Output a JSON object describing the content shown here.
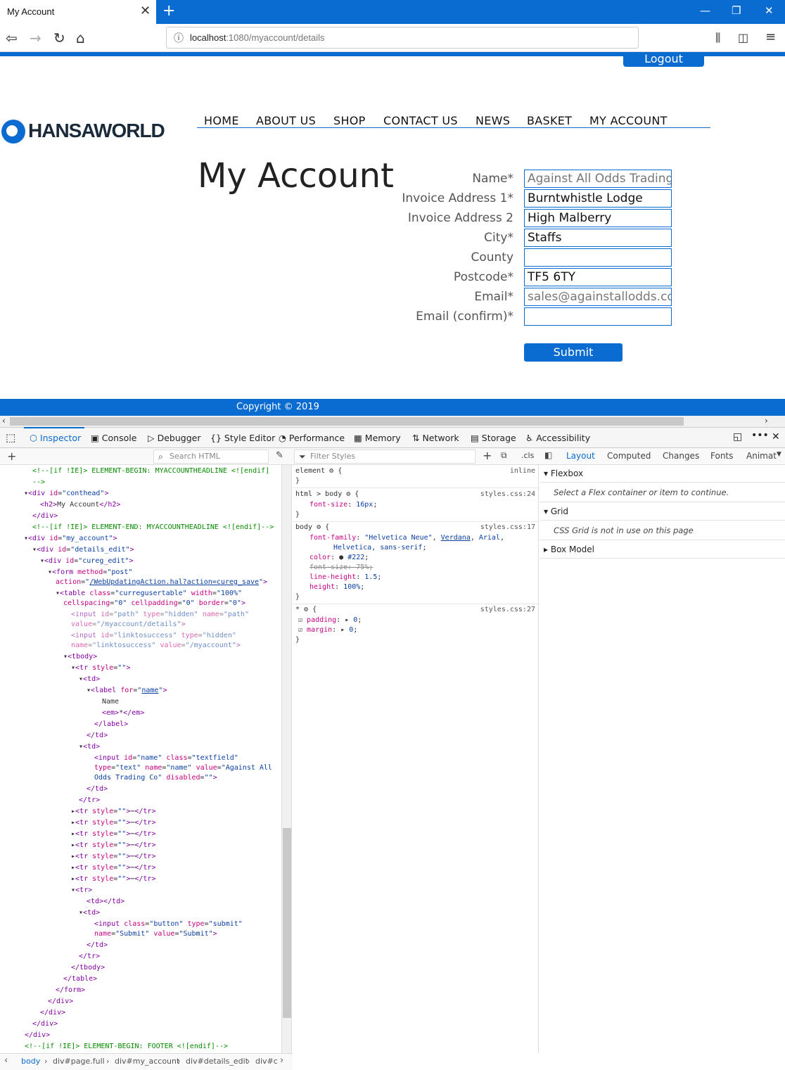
{
  "browser": {
    "tab_title": "My Account",
    "url_host": "localhost",
    "url_path": ":1080/myaccount/details"
  },
  "site": {
    "logout_label": "Logout",
    "logo_text": "HANSAWORLD",
    "menu": [
      "HOME",
      "ABOUT US",
      "SHOP",
      "CONTACT US",
      "NEWS",
      "BASKET",
      "MY ACCOUNT"
    ],
    "page_title": "My Account",
    "form": {
      "fields": [
        {
          "label": "Name*",
          "value": "Against All Odds Trading",
          "disabled": true
        },
        {
          "label": "Invoice Address 1*",
          "value": "Burntwhistle Lodge",
          "disabled": false
        },
        {
          "label": "Invoice Address 2",
          "value": "High Malberry",
          "disabled": false
        },
        {
          "label": "City*",
          "value": "Staffs",
          "disabled": false
        },
        {
          "label": "County",
          "value": "",
          "disabled": false
        },
        {
          "label": "Postcode*",
          "value": "TF5 6TY",
          "disabled": false
        },
        {
          "label": "Email*",
          "value": "sales@againstallodds.com",
          "disabled": true
        },
        {
          "label": "Email (confirm)*",
          "value": "",
          "disabled": false
        }
      ],
      "submit_label": "Submit"
    },
    "footer": "Copyright © 2019"
  },
  "devtools": {
    "tabs": [
      "Inspector",
      "Console",
      "Debugger",
      "Style Editor",
      "Performance",
      "Memory",
      "Network",
      "Storage",
      "Accessibility"
    ],
    "search_html_placeholder": "Search HTML",
    "filter_styles_placeholder": "Filter Styles",
    "cls_label": ".cls",
    "side_tabs": [
      "Layout",
      "Computed",
      "Changes",
      "Fonts",
      "Animat"
    ],
    "layout_sections": [
      {
        "title": "Flexbox",
        "note": "Select a Flex container or item to continue."
      },
      {
        "title": "Grid",
        "note": "CSS Grid is not in use on this page"
      },
      {
        "title": "Box Model",
        "note": ""
      }
    ],
    "breadcrumbs": [
      "body",
      "div#page.full",
      "div#my_account",
      "div#details_edit",
      "div#c"
    ]
  }
}
